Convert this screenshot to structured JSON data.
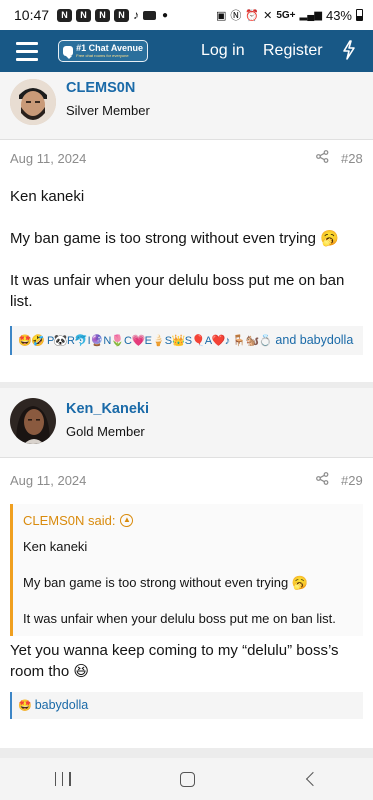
{
  "status_bar": {
    "time": "10:47",
    "notification_icons": [
      "n-icon",
      "n-icon",
      "n-icon",
      "n-icon",
      "tiktok-icon",
      "youtube-icon"
    ],
    "network": "5G+",
    "battery": "43%"
  },
  "header": {
    "logo_main": "#1 Chat Avenue",
    "logo_sub": "Free chat rooms for everyone",
    "login_label": "Log in",
    "register_label": "Register",
    "brand_color": "#185886"
  },
  "posts": [
    {
      "username": "CLEMS0N",
      "user_title": "Silver Member",
      "date": "Aug 11, 2024",
      "post_number": "#28",
      "lines": [
        "Ken kaneki",
        "My ban game is too strong without even trying 🥱",
        "It was unfair when your delulu boss put me on ban list."
      ],
      "reactions_emoji": "🤩🤣 P🐼R🐬I🔮N🌷C💗E🍦S👑S🎈A❤️♪ 🪑🐿️💍",
      "reactions_and": "and",
      "reactions_last": "babydolla"
    },
    {
      "username": "Ken_Kaneki",
      "user_title": "Gold Member",
      "date": "Aug 11, 2024",
      "post_number": "#29",
      "quote_author": "CLEMS0N said:",
      "quote_lines": [
        "Ken kaneki",
        "My ban game is too strong without even trying 🥱",
        "It was unfair when your delulu boss put me on ban list."
      ],
      "reply": "Yet you wanna keep coming to my “delulu” boss’s room tho 😆",
      "reactions_emoji": "🤩",
      "reactions_last": "babydolla"
    }
  ]
}
